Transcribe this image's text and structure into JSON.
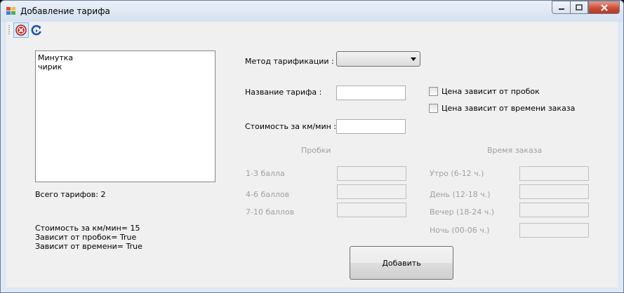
{
  "window": {
    "title": "Добавление тарифа"
  },
  "toolbar": {
    "icons": [
      "close-red-icon",
      "refresh-icon"
    ]
  },
  "tariffs": {
    "items": [
      "Минутка",
      "чирик"
    ],
    "total_label": "Всего тарифов: 2"
  },
  "details": {
    "line1": "Стоимость за км/мин= 15",
    "line2": "Зависит от пробок= True",
    "line3": "Зависит от времени= True"
  },
  "form": {
    "method_label": "Метод тарификации :",
    "method_value": "",
    "name_label": "Название тарифа :",
    "name_value": "",
    "cost_label": "Стоимость за км/мин :",
    "cost_value": "",
    "traffic_checkbox": "Цена зависит от пробок",
    "traffic_checked": false,
    "time_checkbox": "Цена зависит от времени заказа",
    "time_checked": false
  },
  "traffic": {
    "header": "Пробки",
    "rows": [
      "1-3 балла",
      "4-6 баллов",
      "7-10 баллов"
    ]
  },
  "time": {
    "header": "Время заказа",
    "rows": [
      "Утро (6-12 ч.)",
      "День (12-18 ч.)",
      "Вечер (18-24 ч.)",
      "Ночь (00-06 ч.)"
    ]
  },
  "actions": {
    "add_label": "Добавить"
  },
  "colors": {
    "disabled_text": "#a0a0a0",
    "close_button": "#c84a34"
  }
}
